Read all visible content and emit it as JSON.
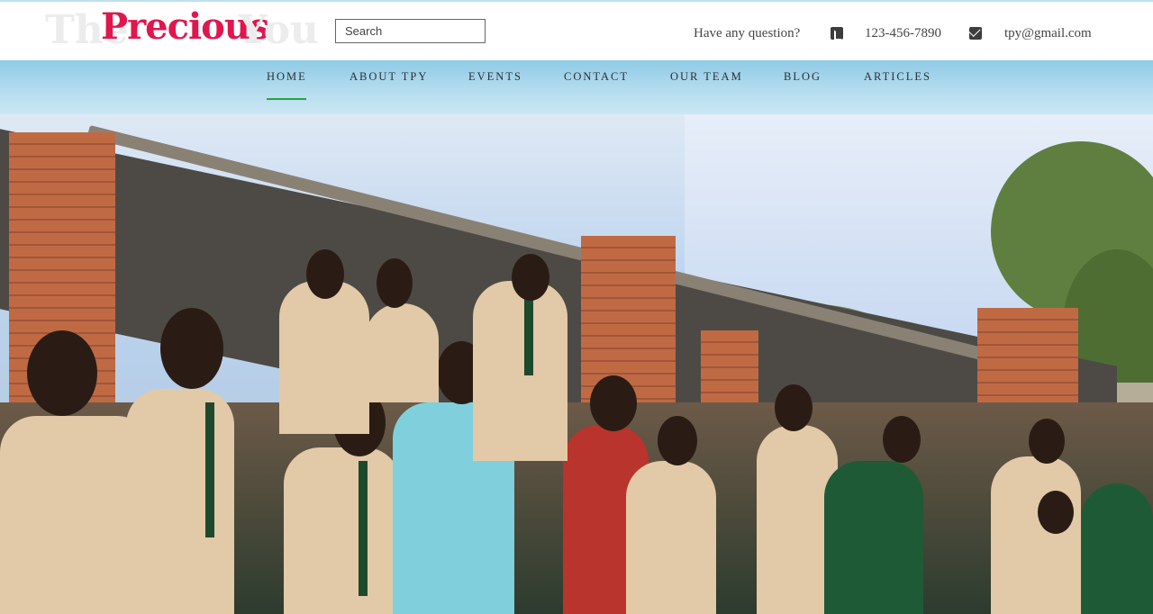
{
  "header": {
    "logo": {
      "part1": "The",
      "part2": "Precious",
      "part3": "You"
    },
    "search": {
      "placeholder": "Search"
    },
    "question_text": "Have any question?",
    "phone": "123-456-7890",
    "email": "tpy@gmail.com",
    "icons": {
      "phone": "phone-icon",
      "email": "envelope-icon"
    }
  },
  "nav": {
    "items": [
      {
        "label": "HOME",
        "active": true
      },
      {
        "label": "ABOUT TPY"
      },
      {
        "label": "EVENTS"
      },
      {
        "label": "CONTACT"
      },
      {
        "label": "OUR TEAM"
      },
      {
        "label": "BLOG"
      },
      {
        "label": "ARTICLES"
      }
    ],
    "active_color": "#2aa13a"
  },
  "colors": {
    "brand": "#e0164e",
    "nav_bg": "#a9d6ec"
  }
}
